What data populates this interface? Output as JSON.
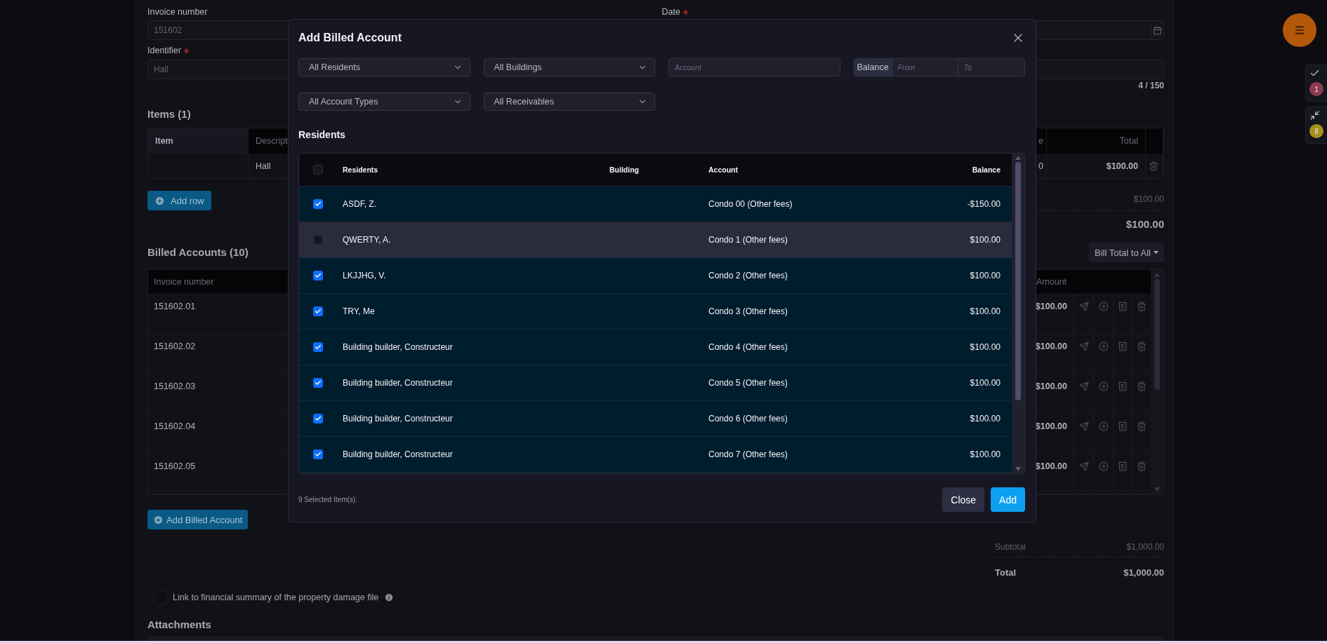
{
  "form": {
    "invoice_number": {
      "label": "Invoice number",
      "value": "151602"
    },
    "date": {
      "label": "Date",
      "required": true
    },
    "identifier": {
      "label": "Identifier",
      "required": true,
      "value": "Hall",
      "counter": "4 / 150"
    }
  },
  "items": {
    "title": "Items (1)",
    "columns": [
      "Item",
      "Descript",
      "e",
      "Total"
    ],
    "rows": [
      {
        "descript": "Hall",
        "column_3": "0",
        "total": "$100.00"
      }
    ],
    "add_button": "Add row",
    "subtotal": "$100.00",
    "total": "$100.00"
  },
  "billed_accounts": {
    "title": "Billed Accounts (10)",
    "bill_button": "Bill Total to All",
    "columns": [
      "Invoice number",
      "Amount"
    ],
    "rows": [
      {
        "invoice_number": "151602.01",
        "amount": "$100.00"
      },
      {
        "invoice_number": "151602.02",
        "amount": "$100.00"
      },
      {
        "invoice_number": "151602.03",
        "amount": "$100.00"
      },
      {
        "invoice_number": "151602.04",
        "amount": "$100.00"
      },
      {
        "invoice_number": "151602.05",
        "amount": "$100.00"
      }
    ],
    "add_button": "Add Billed Account"
  },
  "totals": {
    "subtotal_label": "Subtotal",
    "subtotal": "$1,000.00",
    "total_label": "Total",
    "total": "$1,000.00"
  },
  "link_checkbox": {
    "label": "Link to financial summary of the property damage file",
    "checked": false
  },
  "attachments_title": "Attachments",
  "side_panel": [
    {
      "kind": "check",
      "count": "1",
      "color": "#8e3a52"
    },
    {
      "kind": "collapse",
      "count": "8",
      "color": "#a8901c"
    }
  ],
  "modal": {
    "title": "Add Billed Account",
    "filters": [
      {
        "kind": "select",
        "label": "All Residents"
      },
      {
        "kind": "select",
        "label": "All Buildings"
      },
      {
        "kind": "input",
        "placeholder": "Account"
      },
      {
        "kind": "range",
        "label": "Balance",
        "from_placeholder": "From",
        "to_placeholder": "To"
      },
      {
        "kind": "select",
        "label": "All Account Types"
      },
      {
        "kind": "select",
        "label": "All Receivables"
      }
    ],
    "section_title": "Residents",
    "columns": [
      "Residents",
      "Building",
      "Account",
      "Balance"
    ],
    "select_all": {
      "checked": false
    },
    "rows": [
      {
        "resident": "ASDF, Z.",
        "account": "Condo 00 (Other fees)",
        "balance": "-$150.00",
        "checked": true
      },
      {
        "resident": "QWERTY, A.",
        "account": "Condo 1 (Other fees)",
        "balance": "$100.00",
        "checked": false
      },
      {
        "resident": "LKJJHG, V.",
        "account": "Condo 2 (Other fees)",
        "balance": "$100.00",
        "checked": true
      },
      {
        "resident": "TRY, Me",
        "account": "Condo 3 (Other fees)",
        "balance": "$100.00",
        "checked": true
      },
      {
        "resident": "Building builder, Constructeur",
        "account": "Condo 4 (Other fees)",
        "balance": "$100.00",
        "checked": true
      },
      {
        "resident": "Building builder, Constructeur",
        "account": "Condo 5 (Other fees)",
        "balance": "$100.00",
        "checked": true
      },
      {
        "resident": "Building builder, Constructeur",
        "account": "Condo 6 (Other fees)",
        "balance": "$100.00",
        "checked": true
      },
      {
        "resident": "Building builder, Constructeur",
        "account": "Condo 7 (Other fees)",
        "balance": "$100.00",
        "checked": true
      }
    ],
    "selected_count": "9 Selected Item(s).",
    "buttons": [
      {
        "label": "Close",
        "kind": "secondary"
      },
      {
        "label": "Add",
        "kind": "primary"
      }
    ]
  }
}
